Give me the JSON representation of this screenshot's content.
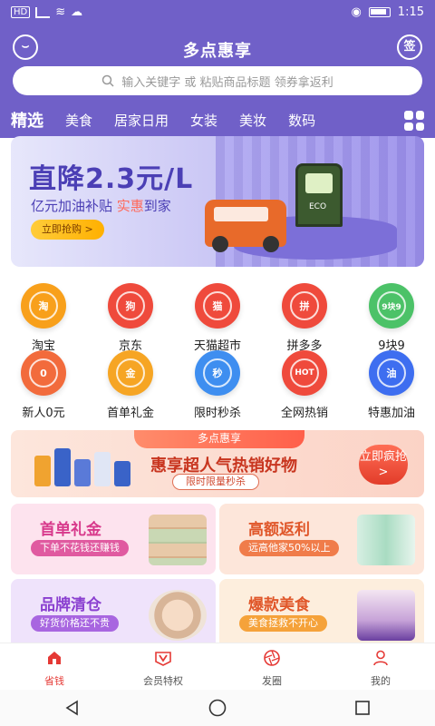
{
  "status_bar": {
    "time": "1:15",
    "carrier": "HD"
  },
  "header": {
    "title": "多点惠享",
    "right_icon_text": "签",
    "search_placeholder": "输入关键字 或 粘贴商品标题 领券拿返利",
    "tabs": [
      "精选",
      "美食",
      "居家日用",
      "女装",
      "美妆",
      "数码"
    ]
  },
  "banner": {
    "headline": "直降2.3元/L",
    "sub_prefix": "亿元加油补贴 ",
    "sub_highlight": "实惠",
    "sub_suffix": "到家",
    "button": "立即抢购 >",
    "pump_label": "ECO"
  },
  "shortcuts": [
    {
      "label": "淘宝",
      "glyph": "淘",
      "color": "#f8a01b"
    },
    {
      "label": "京东",
      "glyph": "狗",
      "color": "#ef4a3c"
    },
    {
      "label": "天猫超市",
      "glyph": "猫",
      "color": "#ef4a3c"
    },
    {
      "label": "拼多多",
      "glyph": "拼",
      "color": "#ef4a3c"
    },
    {
      "label": "9块9",
      "glyph": "9块9",
      "color": "#4cc268"
    },
    {
      "label": "新人0元",
      "glyph": "0",
      "color": "#f26b3c"
    },
    {
      "label": "首单礼金",
      "glyph": "金",
      "color": "#f6a524"
    },
    {
      "label": "限时秒杀",
      "glyph": "秒",
      "color": "#3e8ef0"
    },
    {
      "label": "全网热销",
      "glyph": "HOT",
      "color": "#ef4a3c"
    },
    {
      "label": "特惠加油",
      "glyph": "油",
      "color": "#3e6ef0"
    }
  ],
  "promo": {
    "tag": "多点惠享",
    "title": "惠享超人气热销好物",
    "subtitle": "限时限量秒杀",
    "button": "立即疯抢 >"
  },
  "cards": [
    {
      "title": "首单礼金",
      "subtitle": "下单不花钱还赚钱",
      "title_color": "#d83a8c",
      "sub_color": "#e05aa0",
      "bg": "#fde3ee"
    },
    {
      "title": "高额返利",
      "subtitle": "远高他家50%以上",
      "title_color": "#e0572a",
      "sub_color": "#f07c4a",
      "bg": "#fde6da"
    },
    {
      "title": "品牌清仓",
      "subtitle": "好货价格还不贵",
      "title_color": "#8a3fd0",
      "sub_color": "#a866e0",
      "bg": "#efe3fb"
    },
    {
      "title": "爆款美食",
      "subtitle": "美食拯救不开心",
      "title_color": "#e0572a",
      "sub_color": "#f5a23a",
      "bg": "#fdeedd"
    }
  ],
  "bottom_nav": [
    {
      "label": "省钱",
      "active": true
    },
    {
      "label": "会员特权",
      "active": false
    },
    {
      "label": "发圈",
      "active": false
    },
    {
      "label": "我的",
      "active": false
    }
  ],
  "colors": {
    "brand": "#7060c8",
    "accent": "#e53935"
  }
}
